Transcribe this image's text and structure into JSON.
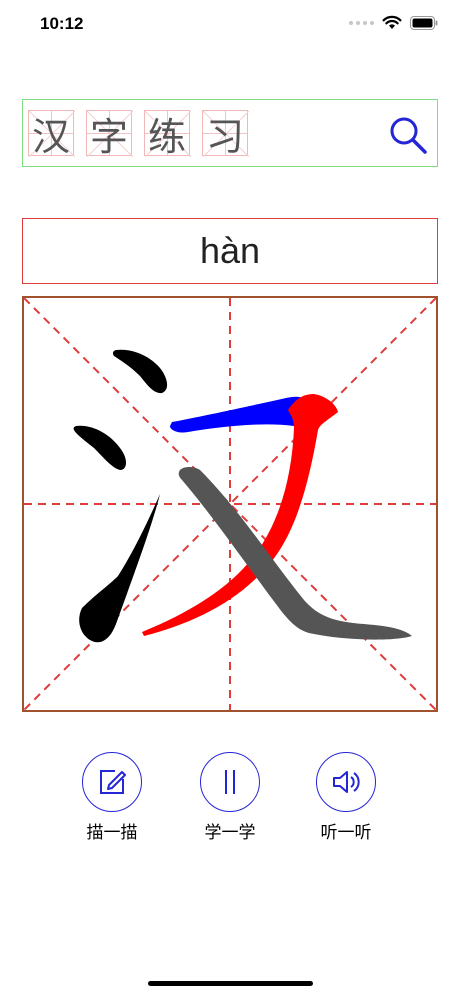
{
  "status_bar": {
    "time": "10:12"
  },
  "title": {
    "chars": [
      "汉",
      "字",
      "练",
      "习"
    ]
  },
  "pinyin": "hàn",
  "actions": [
    {
      "label": "描一描",
      "icon": "edit-icon"
    },
    {
      "label": "学一学",
      "icon": "pause-icon"
    },
    {
      "label": "听一听",
      "icon": "speaker-icon"
    }
  ],
  "colors": {
    "accent_blue": "#2525d8",
    "grid_line_red": "#e03c3c",
    "grid_border": "#a0522d",
    "title_border": "#7fdc7f",
    "stroke_black": "#000000",
    "stroke_blue": "#0000ff",
    "stroke_red": "#ff0000",
    "stroke_gray": "#555555"
  }
}
